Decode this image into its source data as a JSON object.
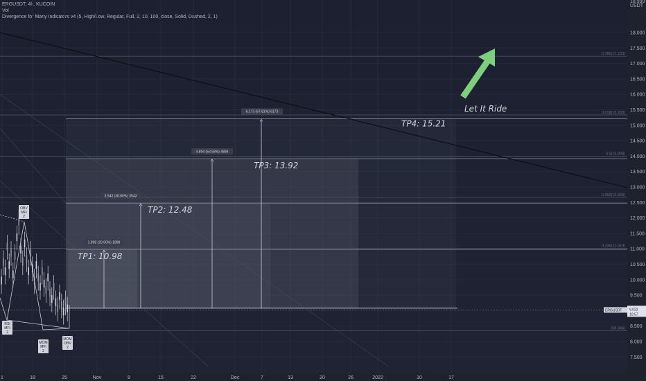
{
  "header": {
    "title": "ERGUSDT, 4h, KUCOIN",
    "line2": "Vol",
    "line3": "Divergence for Many Indicators v4 (5, High/Low, Regular, Full, 2, 10, 100, close, Solid, Dashed, 2, 1)"
  },
  "axis": {
    "y_ticks": [
      "18.000",
      "17.500",
      "17.000",
      "16.500",
      "16.000",
      "15.500",
      "15.000",
      "14.500",
      "14.000",
      "13.500",
      "13.000",
      "12.500",
      "12.000",
      "11.500",
      "11.000",
      "10.500",
      "10.000",
      "9.500",
      "9.000",
      "8.500",
      "8.000",
      "7.500"
    ],
    "y_top_label": "18.999",
    "y_unit": "USDT",
    "x_ticks": [
      "1",
      "18",
      "25",
      "Nov",
      "8",
      "15",
      "22",
      "Dec",
      "7",
      "13",
      "20",
      "26",
      "2022",
      "10",
      "17"
    ]
  },
  "price_tag": {
    "symbol": "ERGUSDT",
    "price": "9.022",
    "time": "10:57"
  },
  "fib_levels": [
    "0.786(17.233)",
    "0.618(15.333)",
    "0.5(13.999)",
    "0.382(12.668)",
    "0.236(11.019)",
    "0(8.346)"
  ],
  "measures": [
    {
      "text": "1.898 (20.90%) 1898",
      "tp": "TP1: 10.98"
    },
    {
      "text": "3.543 (38.80%) 3543",
      "tp": "TP2: 12.48"
    },
    {
      "text": "4.894 (53.58%) 4894",
      "tp": "TP3: 13.92"
    },
    {
      "text": "6.173 (67.81%) 6173",
      "tp": "TP4: 15.21"
    }
  ],
  "annotation": "Let It Ride",
  "div_labels": [
    {
      "lines": [
        "OBV",
        "MFI",
        "2"
      ]
    },
    {
      "lines": [
        "RSI",
        "MFI",
        "2"
      ]
    },
    {
      "lines": [
        "MOM",
        "MFI",
        "2"
      ]
    },
    {
      "lines": [
        "MOM",
        "OBV",
        "2"
      ]
    }
  ],
  "colors": {
    "bg": "#1f2333",
    "arrow": "#7ccf7c",
    "text": "#d1d4dc"
  },
  "chart_data": {
    "type": "line",
    "title": "ERGUSDT, 4h, KUCOIN",
    "ylabel": "USDT",
    "ylim": [
      7.2,
      19.0
    ],
    "entry": 9.08,
    "targets": [
      {
        "name": "TP1",
        "value": 10.98
      },
      {
        "name": "TP2",
        "value": 12.48
      },
      {
        "name": "TP3",
        "value": 13.92
      },
      {
        "name": "TP4",
        "value": 15.21
      }
    ],
    "fib": [
      {
        "ratio": 0.786,
        "value": 17.233
      },
      {
        "ratio": 0.618,
        "value": 15.333
      },
      {
        "ratio": 0.5,
        "value": 13.999
      },
      {
        "ratio": 0.382,
        "value": 12.668
      },
      {
        "ratio": 0.236,
        "value": 11.019
      },
      {
        "ratio": 0,
        "value": 8.346
      }
    ],
    "last_price": 9.022,
    "grid": true
  }
}
